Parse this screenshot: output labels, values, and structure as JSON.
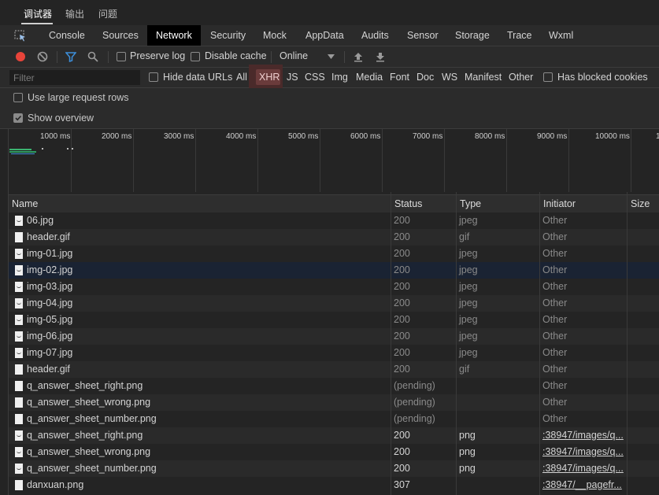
{
  "top_tabs": [
    {
      "label": "调试器",
      "active": true
    },
    {
      "label": "输出",
      "active": false
    },
    {
      "label": "问题",
      "active": false
    }
  ],
  "panel_tabs": [
    {
      "label": "Console"
    },
    {
      "label": "Sources"
    },
    {
      "label": "Network",
      "active": true
    },
    {
      "label": "Security"
    },
    {
      "label": "Mock"
    },
    {
      "label": "AppData"
    },
    {
      "label": "Audits"
    },
    {
      "label": "Sensor"
    },
    {
      "label": "Storage"
    },
    {
      "label": "Trace"
    },
    {
      "label": "Wxml"
    }
  ],
  "toolbar": {
    "preserve_log": "Preserve log",
    "disable_cache": "Disable cache",
    "throttle": "Online"
  },
  "filterbar": {
    "placeholder": "Filter",
    "hide_data_urls": "Hide data URLs",
    "types": [
      "All",
      "XHR",
      "JS",
      "CSS",
      "Img",
      "Media",
      "Font",
      "Doc",
      "WS",
      "Manifest",
      "Other"
    ],
    "active_type": "XHR",
    "blocked_cookies": "Has blocked cookies"
  },
  "options": {
    "large_rows": "Use large request rows",
    "show_overview": "Show overview"
  },
  "overview": {
    "ticks": [
      "1000 ms",
      "2000 ms",
      "3000 ms",
      "4000 ms",
      "5000 ms",
      "6000 ms",
      "7000 ms",
      "8000 ms",
      "9000 ms",
      "10000 ms",
      "1"
    ]
  },
  "table": {
    "columns": [
      "Name",
      "Status",
      "Type",
      "Initiator",
      "Size"
    ],
    "rows": [
      {
        "name": "06.jpg",
        "status": "200",
        "type": "jpeg",
        "initiator": "Other",
        "dim": true,
        "icon": "image"
      },
      {
        "name": "header.gif",
        "status": "200",
        "type": "gif",
        "initiator": "Other",
        "dim": true,
        "icon": "file"
      },
      {
        "name": "img-01.jpg",
        "status": "200",
        "type": "jpeg",
        "initiator": "Other",
        "dim": true,
        "icon": "image"
      },
      {
        "name": "img-02.jpg",
        "status": "200",
        "type": "jpeg",
        "initiator": "Other",
        "dim": true,
        "icon": "image",
        "selected": true
      },
      {
        "name": "img-03.jpg",
        "status": "200",
        "type": "jpeg",
        "initiator": "Other",
        "dim": true,
        "icon": "image"
      },
      {
        "name": "img-04.jpg",
        "status": "200",
        "type": "jpeg",
        "initiator": "Other",
        "dim": true,
        "icon": "image"
      },
      {
        "name": "img-05.jpg",
        "status": "200",
        "type": "jpeg",
        "initiator": "Other",
        "dim": true,
        "icon": "image"
      },
      {
        "name": "img-06.jpg",
        "status": "200",
        "type": "jpeg",
        "initiator": "Other",
        "dim": true,
        "icon": "image"
      },
      {
        "name": "img-07.jpg",
        "status": "200",
        "type": "jpeg",
        "initiator": "Other",
        "dim": true,
        "icon": "image"
      },
      {
        "name": "header.gif",
        "status": "200",
        "type": "gif",
        "initiator": "Other",
        "dim": true,
        "icon": "file"
      },
      {
        "name": "q_answer_sheet_right.png",
        "status": "(pending)",
        "type": "",
        "initiator": "Other",
        "dim": true,
        "icon": "file"
      },
      {
        "name": "q_answer_sheet_wrong.png",
        "status": "(pending)",
        "type": "",
        "initiator": "Other",
        "dim": true,
        "icon": "file"
      },
      {
        "name": "q_answer_sheet_number.png",
        "status": "(pending)",
        "type": "",
        "initiator": "Other",
        "dim": true,
        "icon": "file"
      },
      {
        "name": "q_answer_sheet_right.png",
        "status": "200",
        "type": "png",
        "initiator": ":38947/images/q...",
        "dim": false,
        "link": true,
        "icon": "image"
      },
      {
        "name": "q_answer_sheet_wrong.png",
        "status": "200",
        "type": "png",
        "initiator": ":38947/images/q...",
        "dim": false,
        "link": true,
        "icon": "image"
      },
      {
        "name": "q_answer_sheet_number.png",
        "status": "200",
        "type": "png",
        "initiator": ":38947/images/q...",
        "dim": false,
        "link": true,
        "icon": "image"
      },
      {
        "name": "danxuan.png",
        "status": "307",
        "type": "",
        "initiator": ":38947/__pagefr...",
        "dim": false,
        "link": true,
        "icon": "file"
      }
    ]
  },
  "colors": {
    "record_button": "#e8443a",
    "filter_icon_active": "#3d8fdb",
    "selected_row": "#1a2333"
  }
}
